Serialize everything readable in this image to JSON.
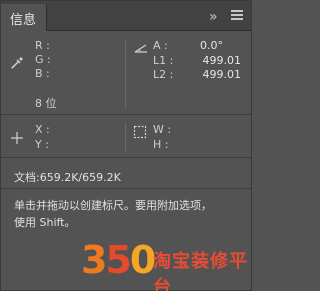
{
  "panel": {
    "tab_label": "信息",
    "collapse_glyph": "»",
    "colors": {
      "background": "#535353",
      "header": "#424242",
      "text": "#d6d6d6"
    }
  },
  "color_section": {
    "icon": "eyedropper-icon",
    "labels": [
      "R :",
      "G :",
      "B :"
    ],
    "bit_depth": "8 位"
  },
  "angle_section": {
    "icon": "angle-icon",
    "rows": [
      {
        "label": "A :",
        "value": "0.0°"
      },
      {
        "label": "L1 :",
        "value": "499.01"
      },
      {
        "label": "L2 :",
        "value": "499.01"
      }
    ]
  },
  "position_section": {
    "icon": "crosshair-icon",
    "labels": [
      "X :",
      "Y :"
    ]
  },
  "size_section": {
    "icon": "selection-size-icon",
    "labels": [
      "W :",
      "H :"
    ]
  },
  "document_line": "文档:659.2K/659.2K",
  "hint_line1": "单击并拖动以创建标尺。要用附加选项，",
  "hint_line2": "使用 Shift。",
  "watermark": {
    "digits": [
      "3",
      "5",
      "0"
    ],
    "text": "淘宝装修平台"
  }
}
